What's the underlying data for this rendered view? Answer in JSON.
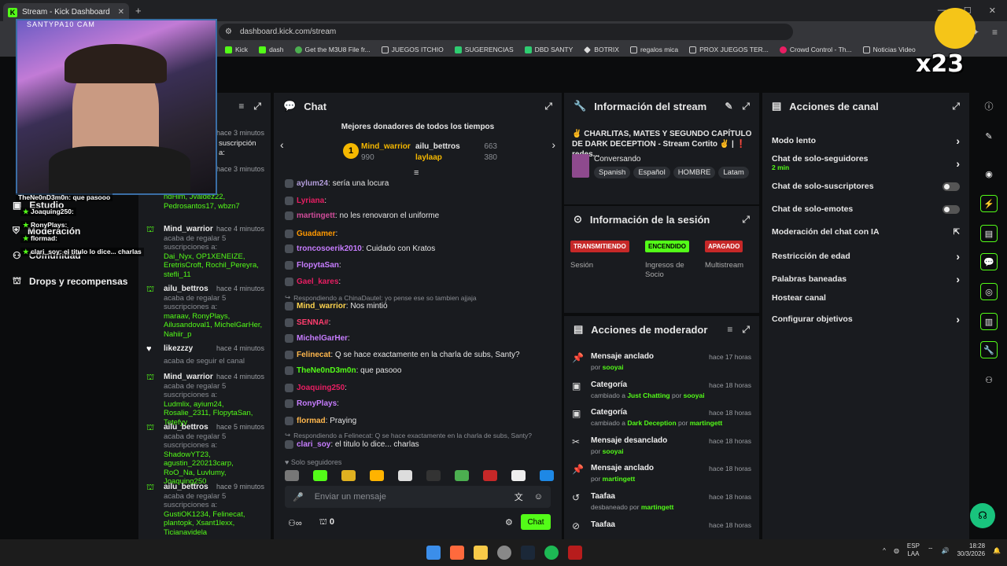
{
  "browser": {
    "tab_title": "Stream - Kick Dashboard",
    "url": "dashboard.kick.com/stream",
    "bookmarks": [
      "Kick",
      "dash",
      "Get the M3U8 File fr...",
      "JUEGOS ITCHIO",
      "SUGERENCIAS",
      "DBD SANTY",
      "BOTRIX",
      "regalos mica",
      "PROX JUEGOS TER...",
      "Crowd Control - Th...",
      "Noticias Video"
    ]
  },
  "webcam": {
    "title": "SANTYPA10 CAM"
  },
  "overlay_chat": [
    {
      "user": "TheNe0nD3m0n",
      "text": ": que pasooo"
    },
    {
      "user": "Joaquing250",
      "text": ":"
    },
    {
      "user": "RonyPlays",
      "text": ":"
    },
    {
      "user": "flormad",
      "text": ":"
    },
    {
      "user": "clari_soy",
      "text": ": el titulo lo dice... charlas"
    }
  ],
  "sidebar": {
    "items": [
      {
        "label": "Estudio"
      },
      {
        "label": "Moderación"
      },
      {
        "label": "Comunidad"
      },
      {
        "label": "Drops y recompensas"
      }
    ]
  },
  "feed": {
    "partial": [
      {
        "time": "hace 3 minutos",
        "text": "suscripción a:"
      },
      {
        "time": "hace 3 minutos",
        "text": ""
      },
      {
        "users": "ndHim, Jvaldez22, Pedrosantos17, wbzn7"
      }
    ],
    "items": [
      {
        "name": "Mind_warrior",
        "time": "hace 4 minutos",
        "text": "acaba de regalar 5 suscripciones a:",
        "users": "Dai_Nyx, OP1XENEIZE, EretrisCroft, Rochil_Pereyra, stefli_11"
      },
      {
        "name": "ailu_bettros",
        "time": "hace 4 minutos",
        "text": "acaba de regalar 5 suscripciones a:",
        "users": "maraav, RonyPlays, Ailusandoval1, MichelGarHer, Nahiir_p"
      },
      {
        "name": "likezzzy",
        "time": "hace 4 minutos",
        "text": "acaba de seguir el canal",
        "users": ""
      },
      {
        "name": "Mind_warrior",
        "time": "hace 4 minutos",
        "text": "acaba de regalar 5 suscripciones a:",
        "users": "Ludmlix, ayium24, Rosalie_2311, FlopytaSan, Tetefyy"
      },
      {
        "name": "ailu_bettros",
        "time": "hace 5 minutos",
        "text": "acaba de regalar 5 suscripciones a:",
        "users": "ShadowYT23, agustin_220213carp, RoO_Na, Luvlumy, Joaquing250"
      },
      {
        "name": "ailu_bettros",
        "time": "hace 9 minutos",
        "text": "acaba de regalar 5 suscripciones a:",
        "users": "GustiOK1234, Felinecat, plantopk, Xsant1lexx, Ticianavidela"
      }
    ]
  },
  "chat": {
    "title": "Chat",
    "top_donors_title": "Mejores donadores de todos los tiempos",
    "donors": [
      {
        "name": "Mind_warrior",
        "amount": "990"
      },
      {
        "name": "ailu_bettros",
        "amount": "663"
      },
      {
        "name": "laylaap",
        "amount": "380"
      }
    ],
    "messages": [
      {
        "user": "aylum24",
        "text": ": sería una locura",
        "color": "#b39ddb"
      },
      {
        "user": "Lyriana",
        "text": ":",
        "color": "#e91e63"
      },
      {
        "user": "martingett",
        "text": ": no les renovaron el uniforme",
        "color": "#d04c9a"
      },
      {
        "user": "Guadamer",
        "text": ":",
        "color": "#ff9800"
      },
      {
        "user": "troncosoerik2010",
        "text": ": Cuidado con Kratos",
        "color": "#c77dff"
      },
      {
        "user": "FlopytaSan",
        "text": ":",
        "color": "#c77dff"
      },
      {
        "user": "Gael_kares",
        "text": ":",
        "color": "#e91e63"
      },
      {
        "reply": "Respondiendo a ChinaDautel: yo pense ese so tambien ajjaja"
      },
      {
        "user": "Mind_warrior",
        "text": ": Nos mintió",
        "color": "#ffd54f"
      },
      {
        "user": "SENNA#",
        "text": ":",
        "color": "#ff3d6e"
      },
      {
        "user": "MichelGarHer",
        "text": ":",
        "color": "#c77dff"
      },
      {
        "user": "Felinecat",
        "text": ": Q se hace exactamente en la charla de subs, Santy?",
        "color": "#ffb74d"
      },
      {
        "user": "TheNe0nD3m0n",
        "text": ": que pasooo",
        "color": "#53fc18"
      },
      {
        "user": "Joaquing250",
        "text": ":",
        "color": "#e91e63"
      },
      {
        "user": "RonyPlays",
        "text": ":",
        "color": "#c77dff"
      },
      {
        "user": "flormad",
        "text": ": Praying",
        "color": "#ffb74d"
      },
      {
        "reply": "Respondiendo a Felinecat: Q se hace exactamente en la charla de subs, Santy?"
      },
      {
        "user": "clari_soy",
        "text": ": el titulo lo dice... charlas",
        "color": "#c77dff"
      }
    ],
    "followers_only": "Solo seguidores",
    "input_placeholder": "Enviar un mensaje",
    "count": "0",
    "send_label": "Chat"
  },
  "stream_info": {
    "title": "Información del stream",
    "stream_title": "✌ CHARLITAS, MATES Y SEGUNDO CAPÍTULO DE DARK DECEPTION - Stream Cortito ✌ | ❗ redes...",
    "category": "Conversando",
    "tags": [
      "Spanish",
      "Español",
      "HOMBRE",
      "Latam"
    ]
  },
  "session": {
    "title": "Información de la sesión",
    "statuses": [
      {
        "value": "TRANSMITIENDO",
        "label": "Sesión",
        "color": "#e53935"
      },
      {
        "value": "ENCENDIDO",
        "label": "Ingresos de Socio",
        "color": "#53fc18"
      },
      {
        "value": "APAGADO",
        "label": "Multistream",
        "color": "#e53935"
      }
    ]
  },
  "mod_actions": {
    "title": "Acciones de moderador",
    "items": [
      {
        "title": "Mensaje anclado",
        "pre": "por ",
        "a": "sooyai",
        "mid": "",
        "b": "",
        "time": "hace 17 horas"
      },
      {
        "title": "Categoría",
        "pre": "cambiado a ",
        "a": "Just Chatting",
        "mid": " por ",
        "b": "sooyai",
        "time": "hace 18 horas"
      },
      {
        "title": "Categoría",
        "pre": "cambiado a ",
        "a": "Dark Deception",
        "mid": " por ",
        "b": "martingett",
        "time": "hace 18 horas"
      },
      {
        "title": "Mensaje desanclado",
        "pre": "por ",
        "a": "sooyai",
        "mid": "",
        "b": "",
        "time": "hace 18 horas"
      },
      {
        "title": "Mensaje anclado",
        "pre": "por ",
        "a": "martingett",
        "mid": "",
        "b": "",
        "time": "hace 18 horas"
      },
      {
        "title": "Taafaa",
        "pre": "desbaneado por ",
        "a": "martingett",
        "mid": "",
        "b": "",
        "time": "hace 18 horas"
      },
      {
        "title": "Taafaa",
        "pre": "",
        "a": "",
        "mid": "",
        "b": "",
        "time": "hace 18 horas"
      }
    ]
  },
  "channel_actions": {
    "title": "Acciones de canal",
    "rows": [
      {
        "label": "Modo lento",
        "sub": ""
      },
      {
        "label": "Chat de solo-seguidores",
        "sub": "2 min"
      },
      {
        "label": "Chat de solo-suscriptores",
        "sub": ""
      },
      {
        "label": "Chat de solo-emotes",
        "sub": ""
      },
      {
        "label": "Moderación del chat con IA",
        "sub": ""
      },
      {
        "label": "Restricción de edad",
        "sub": ""
      },
      {
        "label": "Palabras baneadas",
        "sub": ""
      },
      {
        "label": "Hostear canal",
        "sub": ""
      },
      {
        "label": "Configurar objetivos",
        "sub": ""
      }
    ]
  },
  "overlay_badge": "x23",
  "taskbar": {
    "lang1": "ESP",
    "lang2": "LAA",
    "time": "18:28",
    "date": "30/3/2026"
  }
}
